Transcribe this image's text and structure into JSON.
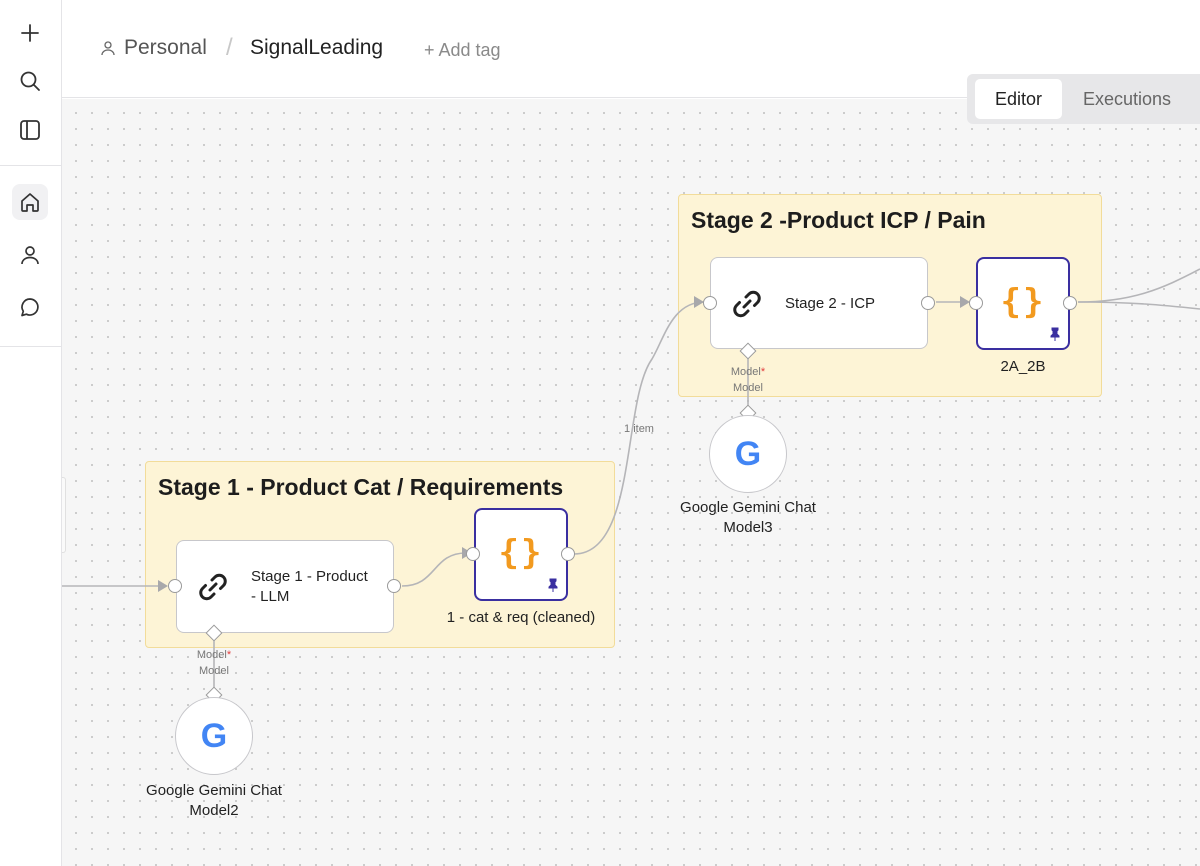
{
  "sidebar": {
    "items": [
      {
        "name": "new",
        "icon": "plus-icon"
      },
      {
        "name": "search",
        "icon": "search-icon"
      },
      {
        "name": "toggle",
        "icon": "panel-icon"
      },
      {
        "name": "home",
        "icon": "home-icon",
        "active": true
      },
      {
        "name": "user",
        "icon": "user-icon"
      },
      {
        "name": "chat",
        "icon": "chat-icon"
      }
    ]
  },
  "header": {
    "breadcrumb_personal": "Personal",
    "separator": "/",
    "workflow_name": "SignalLeading",
    "add_tag": "+ Add tag",
    "tabs": [
      {
        "label": "Editor",
        "active": true
      },
      {
        "label": "Executions",
        "active": false
      }
    ]
  },
  "canvas": {
    "stage1": {
      "title": "Stage 1 - Product Cat / Requirements",
      "agent_label_line1": "Stage 1 - Product",
      "agent_label_line2": "- LLM",
      "code_label": "1 - cat & req (cleaned)",
      "model_port_label": "Model",
      "model_required_mark": "*",
      "model_sub_label": "Model",
      "model_node_line1": "Google Gemini Chat",
      "model_node_line2": "Model2"
    },
    "stage2": {
      "title": "Stage 2 -Product ICP / Pain",
      "agent_label": "Stage 2 - ICP",
      "code_label": "2A_2B",
      "model_port_label": "Model",
      "model_required_mark": "*",
      "model_sub_label": "Model",
      "model_node_line1": "Google Gemini Chat",
      "model_node_line2": "Model3"
    },
    "edge_label": "1 item",
    "code_glyph": "{}",
    "google_letter": "G"
  },
  "colors": {
    "sticky_bg": "#fdf4d6",
    "code_border": "#3a2fa0",
    "code_glyph": "#f29a1f",
    "required": "#e23b3b",
    "google_blue": "#4285F4",
    "google_red": "#EA4335",
    "google_yellow": "#FBBC05",
    "google_green": "#34A853"
  }
}
